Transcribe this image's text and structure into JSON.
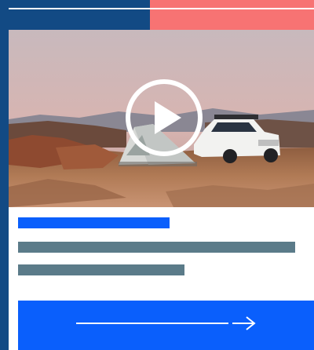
{
  "colors": {
    "navy": "#124a84",
    "coral": "#f77373",
    "accent_blue": "#0a5ffc",
    "slate": "#5b7b89",
    "white": "#ffffff"
  },
  "media": {
    "scene": "campsite-desert-sunset",
    "icon": "play-icon"
  },
  "cta": {
    "icon": "arrow-right-icon"
  }
}
